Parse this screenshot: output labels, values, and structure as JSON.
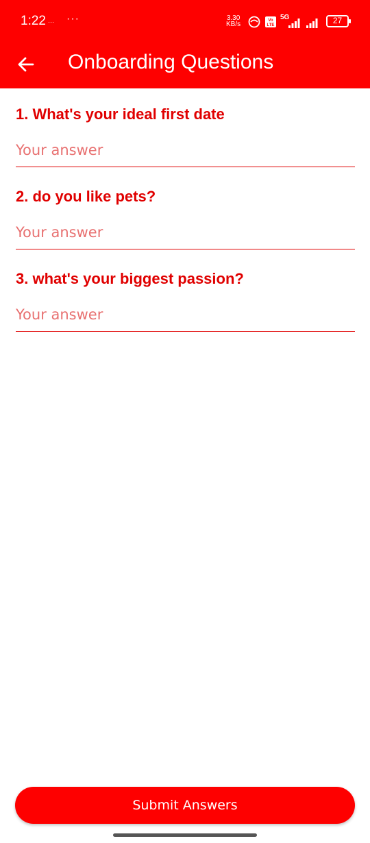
{
  "status_bar": {
    "time": "1:22",
    "small_text": "⋯",
    "dots": "···",
    "speed_value": "3.30",
    "speed_unit": "KB/s",
    "volte": "Vo LTE",
    "network": "5G",
    "battery": "27"
  },
  "app_bar": {
    "title": "Onboarding Questions"
  },
  "questions": [
    {
      "label": "1. What's your ideal first date",
      "placeholder": "Your answer",
      "value": ""
    },
    {
      "label": "2. do you like pets?",
      "placeholder": "Your answer",
      "value": ""
    },
    {
      "label": "3. what's your biggest passion?",
      "placeholder": "Your answer",
      "value": ""
    }
  ],
  "submit_label": "Submit Answers",
  "colors": {
    "primary": "#fe0000",
    "question_text": "#e00000",
    "placeholder": "#e87070",
    "background": "#ffffff"
  }
}
